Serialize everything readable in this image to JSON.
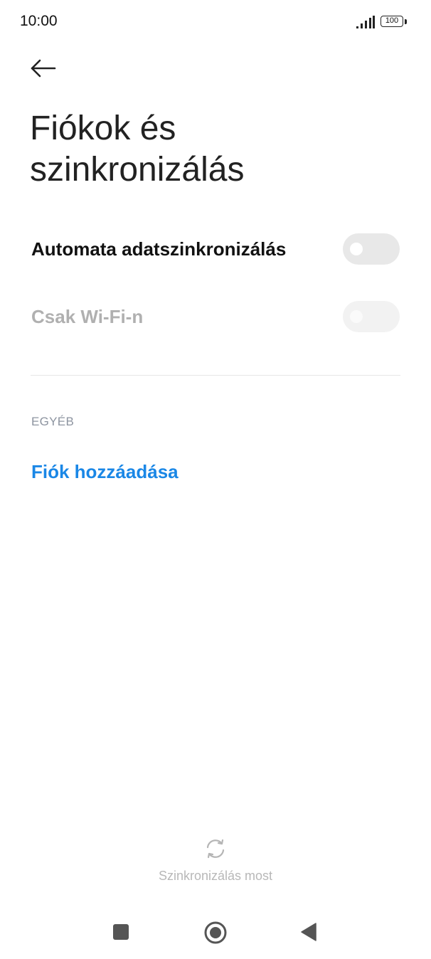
{
  "status_bar": {
    "time": "10:00",
    "battery": "100",
    "icons": [
      "signal-icon",
      "battery-icon"
    ]
  },
  "header": {
    "back_icon": "arrow-left-icon",
    "title_line1": "Fiókok és",
    "title_line2": "szinkronizálás"
  },
  "settings": {
    "auto_sync": {
      "label": "Automata adatszinkronizálás",
      "enabled": false
    },
    "wifi_only": {
      "label": "Csak Wi-Fi-n",
      "enabled": false,
      "disabled": true
    }
  },
  "other_section": {
    "header": "EGYÉB",
    "add_account": "Fiók hozzáadása"
  },
  "footer": {
    "sync_icon": "sync-icon",
    "sync_now": "Szinkronizálás most"
  },
  "nav_bar": {
    "icons": [
      "recent-apps-icon",
      "home-icon",
      "back-icon"
    ]
  },
  "colors": {
    "accent": "#1a87e6",
    "disabled_text": "#b0b0b0",
    "section_header": "#8d94a0",
    "toggle_off": "#e8e8e8"
  }
}
